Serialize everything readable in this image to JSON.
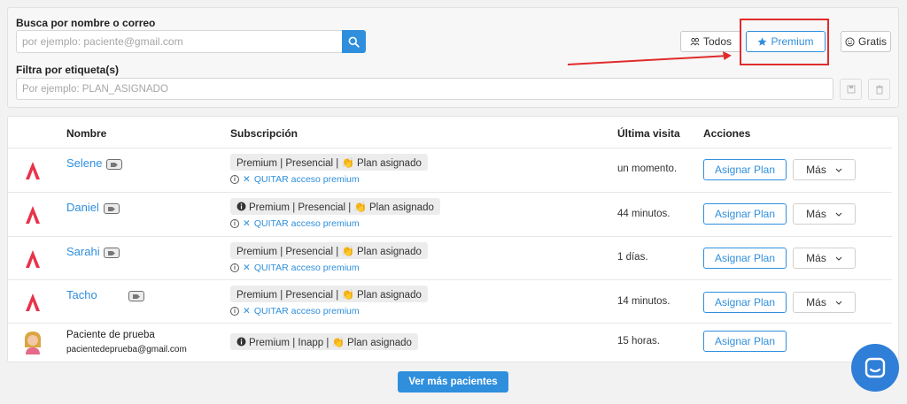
{
  "filters": {
    "search_label": "Busca por nombre o correo",
    "search_placeholder": "por ejemplo: paciente@gmail.com",
    "tag_label": "Filtra por etiqueta(s)",
    "tag_placeholder": "Por ejemplo: PLAN_ASIGNADO",
    "segments": [
      {
        "label": "Todos",
        "icon": "users-icon"
      },
      {
        "label": "Premium",
        "icon": "star-icon",
        "active": true
      },
      {
        "label": "Gratis",
        "icon": "smile-icon"
      }
    ]
  },
  "table": {
    "headers": {
      "nombre": "Nombre",
      "subscripcion": "Subscripción",
      "ultima_visita": "Última visita",
      "acciones": "Acciones"
    },
    "rows": [
      {
        "name": "Selene",
        "subscription": "Premium | Presencial | 👏 Plan asignado",
        "info_badge": false,
        "quitar": "QUITAR acceso premium",
        "visit": "un momento.",
        "assign": "Asignar Plan",
        "more": "Más"
      },
      {
        "name": "Daniel",
        "subscription": "Premium | Presencial | 👏 Plan asignado",
        "info_badge": true,
        "quitar": "QUITAR acceso premium",
        "visit": "44 minutos.",
        "assign": "Asignar Plan",
        "more": "Más"
      },
      {
        "name": "Sarahi",
        "subscription": "Premium | Presencial | 👏 Plan asignado",
        "info_badge": false,
        "quitar": "QUITAR acceso premium",
        "visit": "1 días.",
        "assign": "Asignar Plan",
        "more": "Más"
      },
      {
        "name": "Tacho",
        "subscription": "Premium | Presencial | 👏 Plan asignado",
        "info_badge": false,
        "quitar": "QUITAR acceso premium",
        "visit": "14 minutos.",
        "assign": "Asignar Plan",
        "more": "Más"
      },
      {
        "name": "Paciente de prueba",
        "email": "pacientedeprueba@gmail.com",
        "subscription": "Premium | Inapp | 👏 Plan asignado",
        "info_badge": true,
        "visit": "15 horas.",
        "assign": "Asignar Plan"
      }
    ]
  },
  "footer": {
    "ver_mas": "Ver más pacientes"
  },
  "colors": {
    "accent": "#2f8fdd",
    "highlight": "#e02b2b",
    "brand": "#e8334a"
  }
}
